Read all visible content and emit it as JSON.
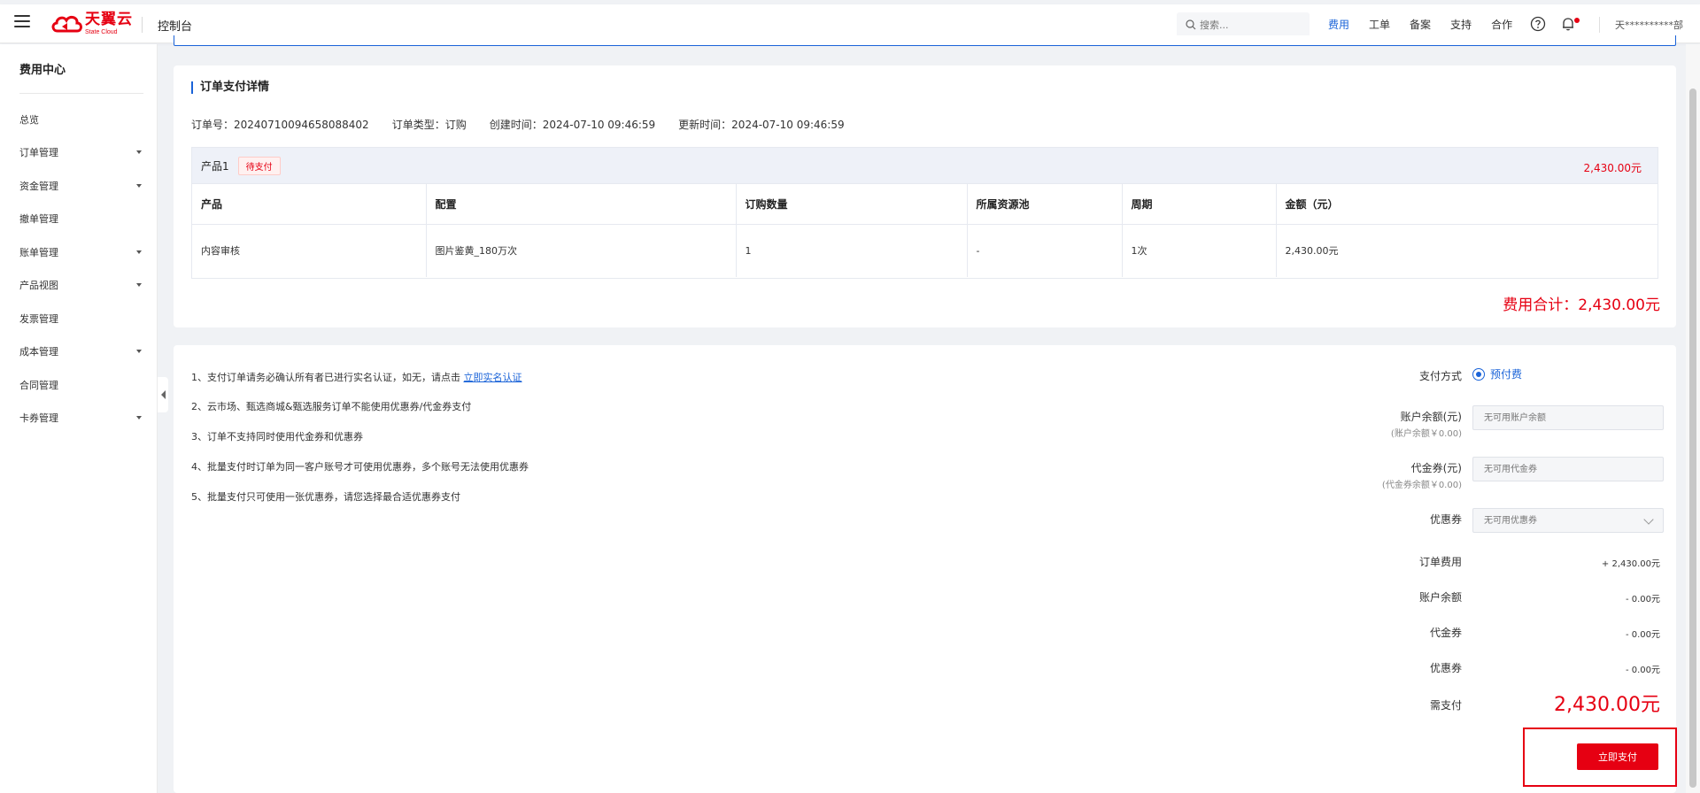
{
  "header": {
    "logo_cn": "天翼云",
    "logo_en": "State Cloud",
    "console_title": "控制台",
    "search_placeholder": "搜索...",
    "nav": [
      "费用",
      "工单",
      "备案",
      "支持",
      "合作"
    ],
    "active_nav": "费用",
    "user_name": "天**********部"
  },
  "sidebar": {
    "title": "费用中心",
    "items": [
      {
        "label": "总览",
        "expandable": false
      },
      {
        "label": "订单管理",
        "expandable": true
      },
      {
        "label": "资金管理",
        "expandable": true
      },
      {
        "label": "撤单管理",
        "expandable": false
      },
      {
        "label": "账单管理",
        "expandable": true
      },
      {
        "label": "产品视图",
        "expandable": true
      },
      {
        "label": "发票管理",
        "expandable": false
      },
      {
        "label": "成本管理",
        "expandable": true
      },
      {
        "label": "合同管理",
        "expandable": false
      },
      {
        "label": "卡券管理",
        "expandable": true
      }
    ]
  },
  "order": {
    "section_title": "订单支付详情",
    "order_no": "订单号：20240710094658088402",
    "order_type": "订单类型：订购",
    "created": "创建时间：2024-07-10 09:46:59",
    "updated": "更新时间：2024-07-10 09:46:59",
    "product_name": "产品1",
    "status_badge": "待支付",
    "product_amount": "2,430.00元",
    "columns": [
      "产品",
      "配置",
      "订购数量",
      "所属资源池",
      "周期",
      "金额（元）"
    ],
    "rows": [
      [
        "内容审核",
        "图片鉴黄_180万次",
        "1",
        "-",
        "1次",
        "2,430.00元"
      ]
    ],
    "fee_total": "费用合计：2,430.00元"
  },
  "notices": [
    "1、支付订单请务必确认所有者已进行实名认证，如无，请点击",
    "2、云市场、甄选商城&甄选服务订单不能使用优惠券/代金券支付",
    "3、订单不支持同时使用代金券和优惠券",
    "4、批量支付时订单为同一客户账号才可使用优惠券，多个账号无法使用优惠券",
    "5、批量支付只可使用一张优惠券，请您选择最合适优惠券支付"
  ],
  "notice_link": "立即实名认证",
  "payment": {
    "method_label": "支付方式",
    "method_value": "预付费",
    "balance_label": "账户余额(元)",
    "balance_sub": "(账户余额￥0.00)",
    "balance_placeholder": "无可用账户余额",
    "voucher_label": "代金券(元)",
    "voucher_sub": "(代金券余额￥0.00)",
    "voucher_placeholder": "无可用代金券",
    "coupon_label": "优惠券",
    "coupon_placeholder": "无可用优惠券",
    "order_fee_label": "订单费用",
    "order_fee_value": "+ 2,430.00元",
    "balance_deduct_label": "账户余额",
    "balance_deduct_value": "- 0.00元",
    "voucher_deduct_label": "代金券",
    "voucher_deduct_value": "- 0.00元",
    "coupon_deduct_label": "优惠券",
    "coupon_deduct_value": "- 0.00元",
    "need_pay_label": "需支付",
    "need_pay_value": "2,430.00元",
    "pay_button": "立即支付"
  },
  "colors": {
    "brand_red": "#e60012",
    "link_blue": "#1a63d8"
  }
}
